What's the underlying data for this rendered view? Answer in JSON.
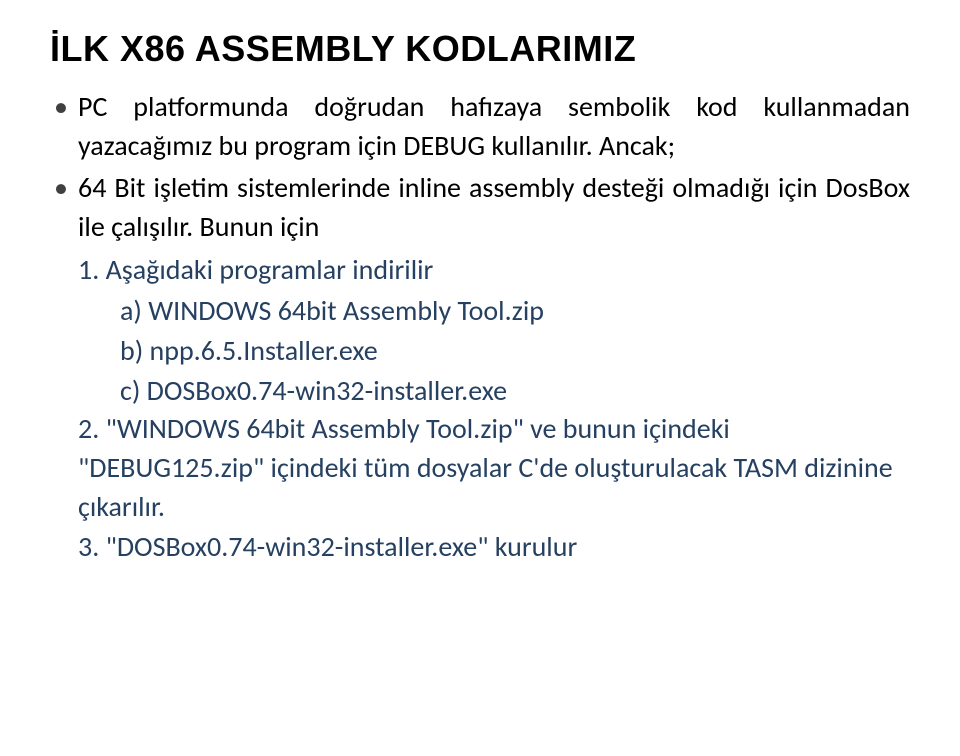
{
  "title": "İLK X86 ASSEMBLY KODLARIMIZ",
  "bullets": [
    "PC platformunda doğrudan hafızaya sembolik kod kullanmadan yazacağımız bu program için DEBUG kullanılır. Ancak;",
    "64 Bit işletim sistemlerinde inline assembly desteği olmadığı için DosBox ile çalışılır. Bunun için"
  ],
  "numbered": {
    "item1": {
      "label": "1. Aşağıdaki programlar indirilir",
      "subs": [
        "a) WINDOWS 64bit Assembly Tool.zip",
        "b) npp.6.5.Installer.exe",
        "c) DOSBox0.74-win32-installer.exe"
      ]
    },
    "item2": "2. \"WINDOWS 64bit Assembly Tool.zip\" ve bunun içindeki \"DEBUG125.zip\" içindeki tüm dosyalar  C'de oluşturulacak TASM dizinine çıkarılır.",
    "item3": "3. \"DOSBox0.74-win32-installer.exe\" kurulur"
  }
}
